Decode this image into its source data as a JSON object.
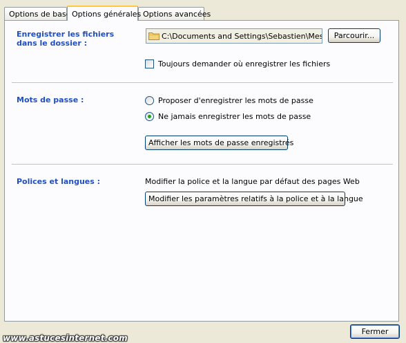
{
  "tabs": [
    {
      "label": "Options de base"
    },
    {
      "label": "Options générales"
    },
    {
      "label": "Options avancées"
    }
  ],
  "active_tab": "Options générales",
  "sections": {
    "save": {
      "label": "Enregistrer les fichiers dans le dossier :",
      "folder_path": "C:\\Documents and Settings\\Sebastien\\Mes docu",
      "browse_label": "Parcourir...",
      "always_ask_label": "Toujours demander où enregistrer les fichiers",
      "always_ask_checked": false
    },
    "passwords": {
      "label": "Mots de passe :",
      "option_save": "Proposer d'enregistrer les mots de passe",
      "option_never": "Ne jamais enregistrer les mots de passe",
      "selected": "Ne jamais enregistrer les mots de passe",
      "show_button": "Afficher les mots de passe enregistrés"
    },
    "fonts": {
      "label": "Polices et langues :",
      "description": "Modifier la police et la langue par défaut des pages Web",
      "modify_button": "Modifier les paramètres relatifs à la police et à la langue"
    }
  },
  "footer": {
    "close_button": "Fermer",
    "watermark": "www.astucesinternet.com"
  },
  "colors": {
    "section_label": "#1f4fbf",
    "radio_selected": "#21a121",
    "dialog_bg": "#ece9d8",
    "panel_bg": "#fcfcfe"
  },
  "icons": {
    "folder": "folder-icon"
  }
}
